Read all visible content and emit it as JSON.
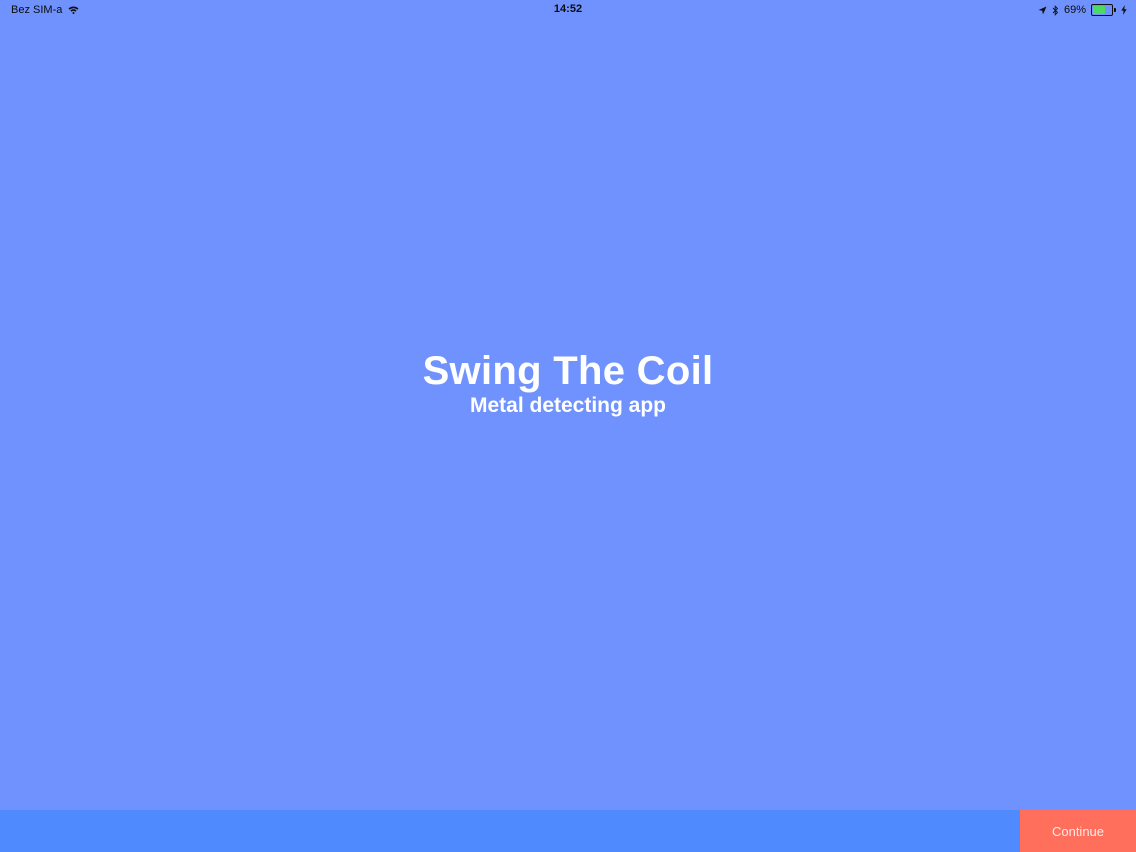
{
  "status_bar": {
    "carrier": "Bez SIM-a",
    "time": "14:52",
    "battery_percent_label": "69%",
    "battery_level": 0.69,
    "icons": [
      "wifi-icon",
      "location-icon",
      "bluetooth-icon",
      "battery-icon",
      "charging-icon"
    ]
  },
  "hero": {
    "title": "Swing The Coil",
    "subtitle": "Metal detecting app"
  },
  "bottom_bar": {
    "continue_label": "Continue"
  },
  "colors": {
    "background": "#6f92ff",
    "bottom_bar": "#4f8bff",
    "continue_button": "#ff6f5c",
    "text": "#ffffff",
    "battery_fill": "#4cd964"
  }
}
